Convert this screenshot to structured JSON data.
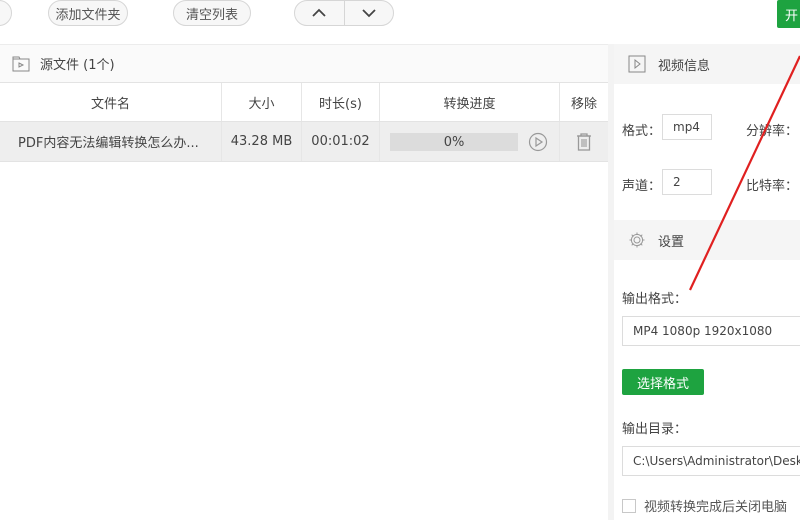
{
  "toolbar": {
    "add_folder": "添加文件夹",
    "clear_list": "清空列表",
    "up_icon": "chevron-up-icon",
    "down_icon": "chevron-down-icon",
    "start_label": "开"
  },
  "left_panel": {
    "title": "源文件 (1个)",
    "columns": [
      "文件名",
      "大小",
      "时长(s)",
      "转换进度",
      "移除"
    ],
    "rows": [
      {
        "name": "PDF内容无法编辑转换怎么办...",
        "size": "43.28 MB",
        "duration": "00:01:02",
        "progress": "0%",
        "progress_value": 0
      }
    ]
  },
  "right_panel": {
    "video_info_title": "视频信息",
    "format_label": "格式：",
    "format_value": "mp4",
    "resolution_label": "分辨率：",
    "channel_label": "声道：",
    "channel_value": "2",
    "bitrate_label": "比特率：",
    "settings_title": "设置",
    "output_format_label": "输出格式：",
    "output_format_value": "MP4 1080p 1920x1080",
    "select_format_button": "选择格式",
    "output_dir_label": "输出目录：",
    "output_dir_value": "C:\\Users\\Administrator\\Deskt",
    "shutdown_checkbox_label": "视频转换完成后关闭电脑"
  },
  "colors": {
    "accent_green": "#1ea340",
    "annotation_red": "#e02020"
  }
}
